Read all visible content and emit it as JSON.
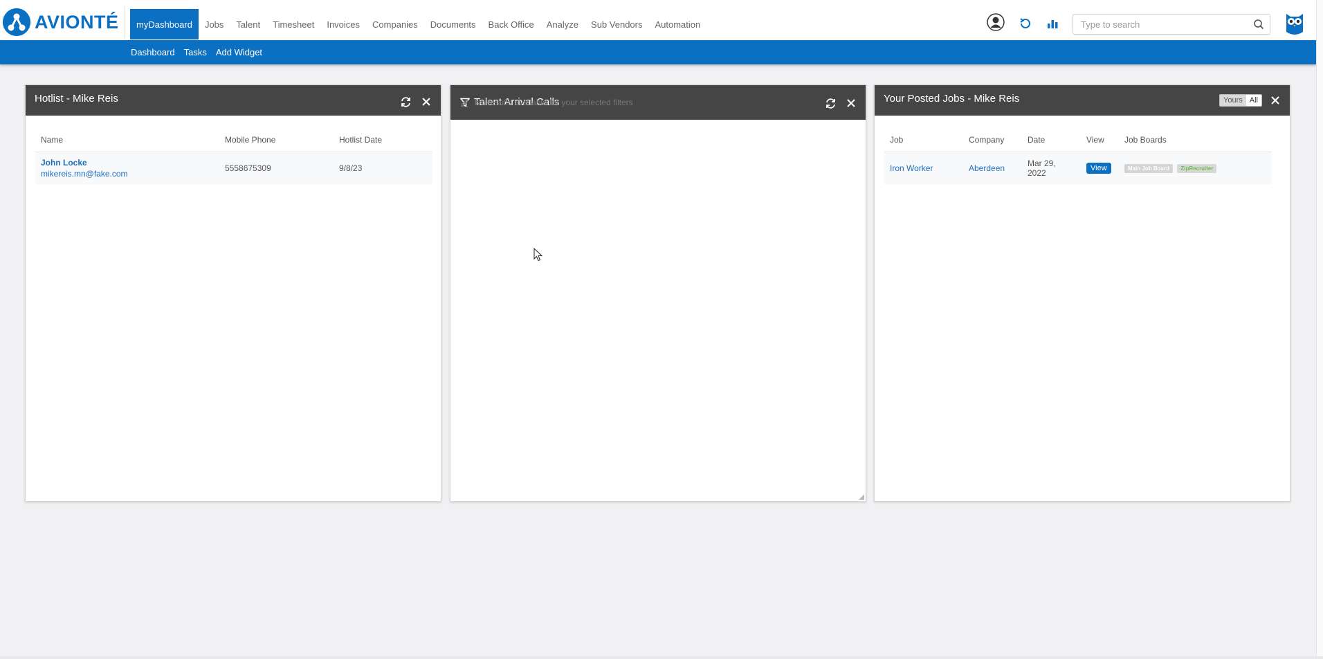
{
  "brand": {
    "name": "AVIONTÉ",
    "color": "#0b6fc2"
  },
  "nav": {
    "items": [
      {
        "label": "myDashboard",
        "active": true
      },
      {
        "label": "Jobs"
      },
      {
        "label": "Talent"
      },
      {
        "label": "Timesheet"
      },
      {
        "label": "Invoices"
      },
      {
        "label": "Companies"
      },
      {
        "label": "Documents"
      },
      {
        "label": "Back Office"
      },
      {
        "label": "Analyze"
      },
      {
        "label": "Sub Vendors"
      },
      {
        "label": "Automation"
      }
    ]
  },
  "toolbar": {
    "icons": [
      "user-icon",
      "refresh-history-icon",
      "bar-chart-icon",
      "owl-icon"
    ]
  },
  "search": {
    "placeholder": "Type to search"
  },
  "subnav": {
    "items": [
      "Dashboard",
      "Tasks",
      "Add Widget"
    ]
  },
  "hotlist": {
    "title": "Hotlist - Mike Reis",
    "columns": [
      "Name",
      "Mobile Phone",
      "Hotlist Date"
    ],
    "rows": [
      {
        "name": "John Locke",
        "email": "mikereis.mn@fake.com",
        "phone": "5558675309",
        "date": "9/8/23"
      }
    ]
  },
  "arrival": {
    "title": "Talent Arrival Calls",
    "empty_message": "No results available for your selected filters"
  },
  "posted": {
    "title": "Your Posted Jobs - Mike Reis",
    "toggle": {
      "yours": "Yours",
      "all": "All"
    },
    "columns": [
      "Job",
      "Company",
      "Date",
      "View",
      "Job Boards"
    ],
    "rows": [
      {
        "job": "Iron Worker",
        "company": "Aberdeen",
        "date_line1": "Mar 29,",
        "date_line2": "2022",
        "view": "View",
        "boards": [
          "Main Job Board",
          "ZipRecruiter"
        ]
      }
    ]
  }
}
